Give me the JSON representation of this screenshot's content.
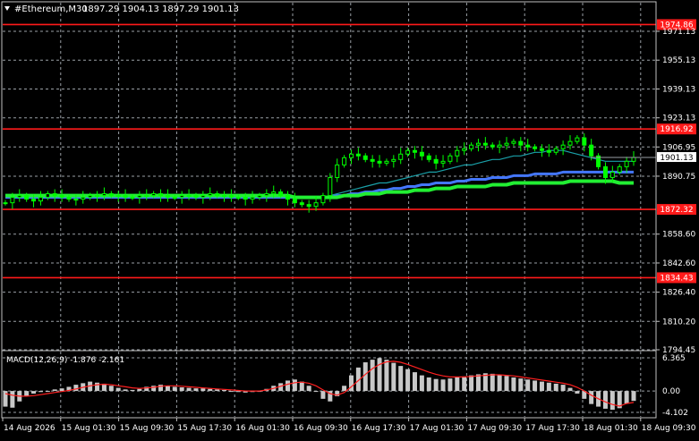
{
  "header": {
    "symbol_timeframe": "#Ethereum,M30",
    "ohlc": "1897.29 1904.13 1897.29 1901.13"
  },
  "colors": {
    "background": "#000000",
    "grid": "#9aa0a6",
    "candles": "#00ff00",
    "level_line": "#ff1a1a",
    "ma_green": "#22ee33",
    "ma_blue": "#4477ff",
    "ma_teal": "#1aa0a8",
    "macd_hist": "#c8c8c8",
    "macd_signal": "#ff2020",
    "current_price_box": "#ffffff"
  },
  "chart_data": {
    "type": "candlestick",
    "title": "#Ethereum,M30",
    "price_axis": {
      "ticks": [
        "1971.13",
        "1955.13",
        "1939.13",
        "1923.13",
        "1906.95",
        "1890.75",
        "1858.60",
        "1842.60",
        "1826.40",
        "1810.20",
        "1794.45"
      ],
      "range": [
        1794.45,
        1987.0
      ]
    },
    "time_axis": {
      "ticks": [
        "14 Aug 2026",
        "15 Aug 01:30",
        "15 Aug 09:30",
        "15 Aug 17:30",
        "16 Aug 01:30",
        "16 Aug 09:30",
        "16 Aug 17:30",
        "17 Aug 01:30",
        "17 Aug 09:30",
        "17 Aug 17:30",
        "18 Aug 01:30",
        "18 Aug 09:30"
      ]
    },
    "current_price": "1901.13",
    "levels": [
      "1974.86",
      "1916.92",
      "1872.32",
      "1834.43"
    ],
    "close_series": [
      1876,
      1879,
      1880,
      1878,
      1877,
      1879,
      1881,
      1880,
      1879,
      1878,
      1878,
      1879,
      1880,
      1880,
      1881,
      1880,
      1880,
      1879,
      1879,
      1880,
      1880,
      1881,
      1880,
      1879,
      1879,
      1880,
      1880,
      1879,
      1880,
      1881,
      1880,
      1880,
      1879,
      1879,
      1878,
      1879,
      1880,
      1881,
      1882,
      1880,
      1878,
      1876,
      1875,
      1874,
      1876,
      1880,
      1890,
      1897,
      1901,
      1903,
      1902,
      1900,
      1899,
      1898,
      1899,
      1900,
      1903,
      1905,
      1904,
      1902,
      1900,
      1898,
      1899,
      1902,
      1905,
      1906,
      1908,
      1909,
      1908,
      1907,
      1908,
      1909,
      1910,
      1908,
      1907,
      1906,
      1905,
      1904,
      1906,
      1908,
      1910,
      1912,
      1908,
      1902,
      1896,
      1890,
      1893,
      1896,
      1899,
      1901.13
    ],
    "moving_averages": [
      {
        "values": [
          1880,
          1880,
          1880,
          1880,
          1880,
          1880,
          1880,
          1880,
          1880,
          1880,
          1880,
          1880,
          1880,
          1880,
          1880,
          1880,
          1880,
          1880,
          1880,
          1880,
          1880,
          1880,
          1880,
          1880,
          1880,
          1880,
          1880,
          1880,
          1880,
          1880,
          1880,
          1880,
          1880,
          1880,
          1880,
          1880,
          1880,
          1880,
          1880,
          1880,
          1880,
          1879,
          1879,
          1879,
          1879,
          1879,
          1879,
          1879,
          1880,
          1880,
          1880,
          1881,
          1881,
          1881,
          1882,
          1882,
          1882,
          1882,
          1883,
          1883,
          1883,
          1884,
          1884,
          1884,
          1885,
          1885,
          1885,
          1885,
          1885,
          1886,
          1886,
          1886,
          1887,
          1887,
          1887,
          1887,
          1887,
          1887,
          1887,
          1887,
          1888,
          1888,
          1888,
          1888,
          1888,
          1888,
          1888,
          1887,
          1887,
          1887
        ]
      },
      {
        "values": [
          1879,
          1879,
          1879,
          1879,
          1879,
          1879,
          1879,
          1879,
          1879,
          1879,
          1879,
          1879,
          1879,
          1879,
          1879,
          1879,
          1879,
          1879,
          1879,
          1879,
          1879,
          1879,
          1879,
          1879,
          1879,
          1879,
          1879,
          1879,
          1879,
          1879,
          1879,
          1879,
          1879,
          1879,
          1879,
          1879,
          1879,
          1879,
          1879,
          1879,
          1879,
          1879,
          1879,
          1879,
          1879,
          1879,
          1879,
          1880,
          1880,
          1881,
          1881,
          1882,
          1882,
          1883,
          1883,
          1884,
          1884,
          1885,
          1885,
          1886,
          1886,
          1887,
          1887,
          1887,
          1888,
          1888,
          1889,
          1889,
          1889,
          1890,
          1890,
          1890,
          1891,
          1891,
          1891,
          1892,
          1892,
          1892,
          1892,
          1893,
          1893,
          1893,
          1893,
          1893,
          1893,
          1893,
          1893,
          1893,
          1893,
          1893
        ]
      },
      {
        "values": [
          1879,
          1879,
          1879,
          1879,
          1879,
          1879,
          1879,
          1879,
          1879,
          1879,
          1879,
          1879,
          1879,
          1879,
          1879,
          1879,
          1879,
          1879,
          1879,
          1879,
          1879,
          1879,
          1879,
          1879,
          1879,
          1879,
          1879,
          1879,
          1879,
          1879,
          1879,
          1879,
          1879,
          1879,
          1879,
          1879,
          1879,
          1879,
          1879,
          1879,
          1879,
          1879,
          1879,
          1879,
          1879,
          1879,
          1880,
          1881,
          1882,
          1883,
          1884,
          1885,
          1886,
          1887,
          1887,
          1888,
          1889,
          1890,
          1891,
          1892,
          1893,
          1893,
          1894,
          1895,
          1896,
          1897,
          1897,
          1898,
          1899,
          1900,
          1900,
          1901,
          1902,
          1902,
          1903,
          1904,
          1904,
          1905,
          1905,
          1905,
          1904,
          1903,
          1902,
          1901,
          1900,
          1899,
          1899,
          1899,
          1899,
          1899
        ]
      }
    ],
    "macd": {
      "label": "MACD(12,26,9) -1.876 -2.161",
      "ticks": [
        "6.365",
        "0.00",
        "-4.102"
      ],
      "range": [
        -4.102,
        6.365
      ],
      "histogram": [
        -3.0,
        -3.2,
        -2.0,
        -1.0,
        -0.5,
        -0.2,
        0.0,
        0.3,
        0.5,
        0.8,
        1.2,
        1.5,
        1.8,
        1.6,
        1.4,
        1.0,
        0.6,
        0.3,
        0.2,
        0.4,
        0.8,
        1.0,
        1.2,
        1.0,
        0.8,
        0.7,
        0.6,
        0.5,
        0.5,
        0.4,
        0.3,
        0.2,
        0.0,
        -0.2,
        -0.3,
        -0.2,
        0.0,
        0.4,
        1.0,
        1.5,
        2.0,
        2.2,
        1.8,
        1.0,
        0.0,
        -1.5,
        -2.0,
        -1.0,
        1.0,
        3.0,
        4.5,
        5.5,
        6.0,
        6.3,
        6.0,
        5.4,
        4.8,
        4.2,
        3.6,
        3.0,
        2.6,
        2.3,
        2.2,
        2.4,
        2.6,
        2.8,
        3.0,
        3.2,
        3.4,
        3.3,
        3.1,
        2.9,
        2.6,
        2.4,
        2.2,
        2.0,
        1.8,
        1.6,
        1.4,
        1.2,
        0.6,
        -0.5,
        -1.5,
        -2.5,
        -3.0,
        -3.4,
        -3.6,
        -3.3,
        -2.4,
        -1.9
      ],
      "signal": [
        -0.5,
        -0.8,
        -1.0,
        -1.0,
        -0.9,
        -0.7,
        -0.5,
        -0.3,
        -0.1,
        0.1,
        0.4,
        0.7,
        1.0,
        1.2,
        1.3,
        1.2,
        1.0,
        0.8,
        0.6,
        0.5,
        0.6,
        0.7,
        0.9,
        1.0,
        1.0,
        0.9,
        0.8,
        0.7,
        0.6,
        0.5,
        0.4,
        0.3,
        0.2,
        0.1,
        0.0,
        0.0,
        0.0,
        0.2,
        0.5,
        0.9,
        1.3,
        1.6,
        1.7,
        1.5,
        1.0,
        0.2,
        -0.5,
        -0.8,
        -0.3,
        0.8,
        2.0,
        3.2,
        4.3,
        5.1,
        5.6,
        5.7,
        5.5,
        5.1,
        4.6,
        4.1,
        3.6,
        3.2,
        2.9,
        2.7,
        2.7,
        2.7,
        2.8,
        2.9,
        3.0,
        3.1,
        3.1,
        3.0,
        2.9,
        2.7,
        2.5,
        2.3,
        2.1,
        1.9,
        1.7,
        1.5,
        1.2,
        0.7,
        0.0,
        -0.8,
        -1.5,
        -2.1,
        -2.6,
        -2.9,
        -2.4,
        -2.2
      ]
    }
  }
}
